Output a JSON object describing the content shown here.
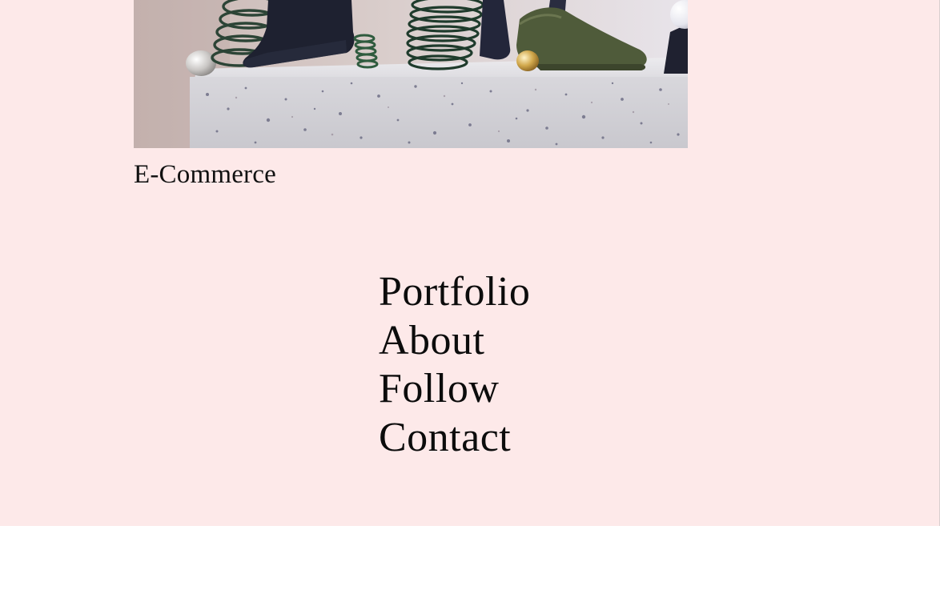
{
  "project": {
    "caption": "E-Commerce",
    "image_alt": "Shoes displayed on a speckled terrazzo block"
  },
  "nav": {
    "items": [
      {
        "label": "Portfolio"
      },
      {
        "label": "About"
      },
      {
        "label": "Follow"
      },
      {
        "label": "Contact"
      }
    ]
  },
  "colors": {
    "panel_background": "#fde9e9",
    "text": "#0c0c0c",
    "page_background": "#ffffff"
  }
}
